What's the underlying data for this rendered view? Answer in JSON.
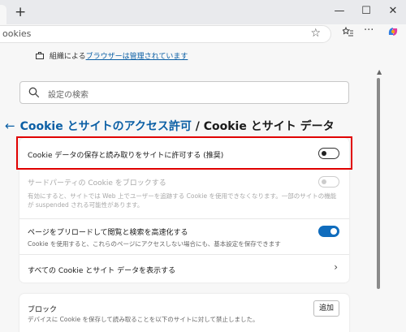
{
  "titlebar": {
    "new_tab_glyph": "+",
    "minimize_glyph": "—",
    "maximize_glyph": "☐",
    "close_glyph": "✕"
  },
  "address_bar": {
    "url_text": "ookies"
  },
  "managed_notice": {
    "prefix": "組織による",
    "link": "ブラウザーは管理されています"
  },
  "search": {
    "placeholder": "設定の検索"
  },
  "heading": {
    "link": "Cookie とサイトのアクセス許可",
    "rest": " / Cookie とサイト データ"
  },
  "settings": {
    "allow_cookies": {
      "title": "Cookie データの保存と読み取りをサイトに許可する (推奨)",
      "enabled": false
    },
    "block_third_party": {
      "title": "サードパーティの Cookie をブロックする",
      "description": "有効にすると、サイトでは Web 上でユーザーを追跡する Cookie を使用できなくなります。一部のサイトの機能が suspended される可能性があります。",
      "enabled": false
    },
    "preload": {
      "title": "ページをプリロードして閲覧と検索を高速化する",
      "description": "Cookie を使用すると、これらのページにアクセスしない場合にも、基本設定を保存できます",
      "enabled": true
    },
    "see_all": {
      "title": "すべての Cookie とサイト データを表示する"
    }
  },
  "block_section": {
    "title": "ブロック",
    "description": "デバイスに Cookie を保存して読み取ることを以下のサイトに対して禁止しました。",
    "add_label": "追加"
  },
  "colors": {
    "accent": "#0f6cbd",
    "link": "#0b5fa5",
    "highlight": "#e00000"
  }
}
